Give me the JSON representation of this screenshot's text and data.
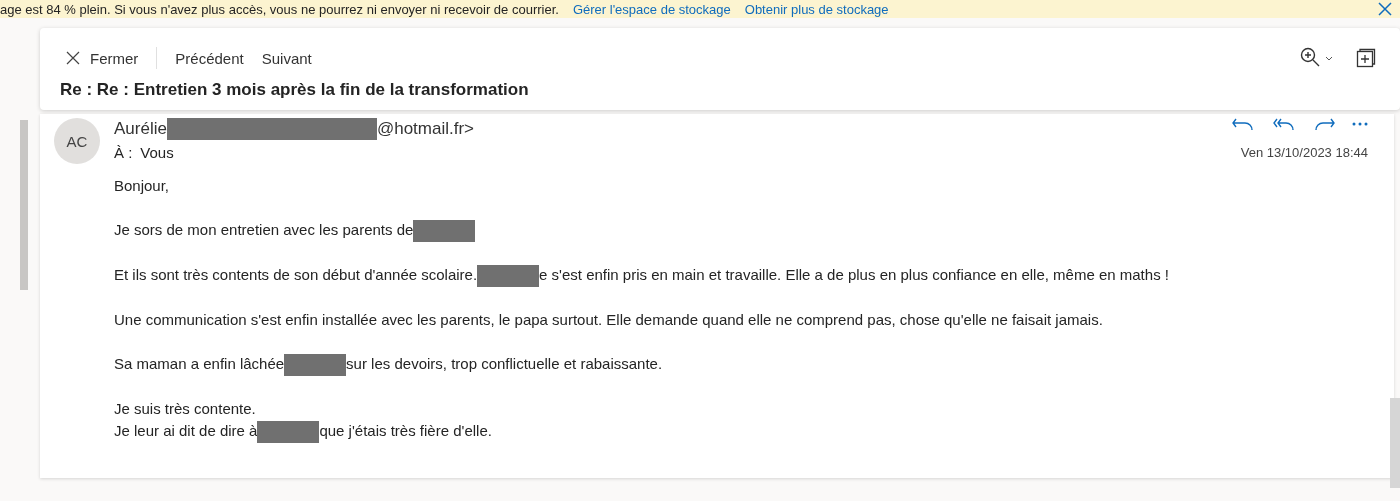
{
  "banner": {
    "message": "age est 84 % plein. Si vous n'avez plus accès, vous ne pourrez ni envoyer ni recevoir de courrier.",
    "links": [
      "Gérer l'espace de stockage",
      "Obtenir plus de stockage"
    ]
  },
  "toolbar": {
    "close": "Fermer",
    "previous": "Précédent",
    "next": "Suivant"
  },
  "subject": "Re : Re : Entretien 3 mois après la fin de la transformation",
  "message": {
    "avatar": "AC",
    "sender": [
      {
        "kind": "text",
        "text": "Aurélie"
      },
      {
        "kind": "redacted_wide"
      },
      {
        "kind": "text",
        "text": "@hotmail.fr>"
      }
    ],
    "to_label": "À :",
    "to": "Vous",
    "date": "Ven 13/10/2023 18:44",
    "body": [
      [
        {
          "kind": "text",
          "text": "Bonjour,"
        }
      ],
      [
        {
          "kind": "text",
          "text": "Je sors de mon entretien avec les parents de"
        },
        {
          "kind": "redacted"
        }
      ],
      [
        {
          "kind": "text",
          "text": "Et ils sont très contents de son début d'année scolaire."
        },
        {
          "kind": "redacted"
        },
        {
          "kind": "text",
          "text": "e s'est enfin pris en main et travaille. Elle a de plus en plus confiance en elle, même en maths !"
        }
      ],
      [
        {
          "kind": "text",
          "text": "Une communication s'est enfin installée avec les parents, le papa surtout. Elle demande quand elle ne comprend pas, chose qu'elle ne faisait jamais."
        }
      ],
      [
        {
          "kind": "text",
          "text": "Sa maman a enfin lâchée"
        },
        {
          "kind": "redacted"
        },
        {
          "kind": "text",
          "text": "sur les devoirs, trop conflictuelle et rabaissante."
        }
      ],
      [
        {
          "kind": "text",
          "text": "Je suis très contente."
        },
        {
          "kind": "break"
        },
        {
          "kind": "text",
          "text": "Je leur ai dit de dire à"
        },
        {
          "kind": "redacted"
        },
        {
          "kind": "text",
          "text": "que j'étais très fière d'elle."
        }
      ]
    ]
  }
}
